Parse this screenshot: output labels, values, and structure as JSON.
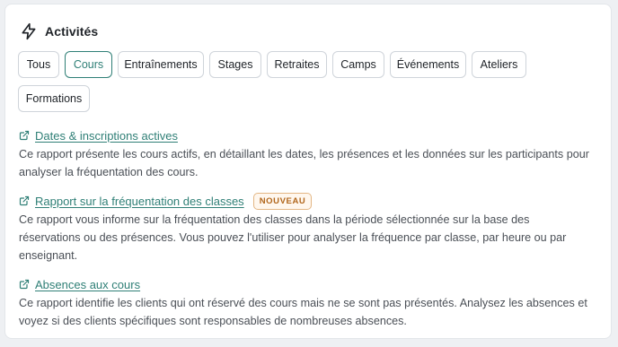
{
  "section": {
    "title": "Activités"
  },
  "filters": [
    {
      "label": "Tous"
    },
    {
      "label": "Cours",
      "active": true
    },
    {
      "label": "Entraînements"
    },
    {
      "label": "Stages"
    },
    {
      "label": "Retraites"
    },
    {
      "label": "Camps"
    },
    {
      "label": "Événements"
    },
    {
      "label": "Ateliers"
    },
    {
      "label": "Formations"
    }
  ],
  "reports": [
    {
      "link": "Dates & inscriptions actives",
      "badge": "",
      "description": "Ce rapport présente les cours actifs, en détaillant les dates, les présences et les données sur les participants pour analyser la fréquentation des cours."
    },
    {
      "link": "Rapport sur la fréquentation des classes",
      "badge": "NOUVEAU",
      "description": "Ce rapport vous informe sur la fréquentation des classes dans la période sélectionnée sur la base des réservations ou des présences. Vous pouvez l'utiliser pour analyser la fréquence par classe, par heure ou par enseignant."
    },
    {
      "link": "Absences aux cours",
      "badge": "",
      "description": "Ce rapport identifie les clients qui ont réservé des cours mais ne se sont pas présentés. Analysez les absences et voyez si des clients spécifiques sont responsables de nombreuses absences."
    }
  ],
  "colors": {
    "accent": "#2f7f76",
    "badge_text": "#b1661b"
  },
  "icons": {
    "header": "lightning-bolt-icon",
    "report_link": "external-link-icon"
  }
}
